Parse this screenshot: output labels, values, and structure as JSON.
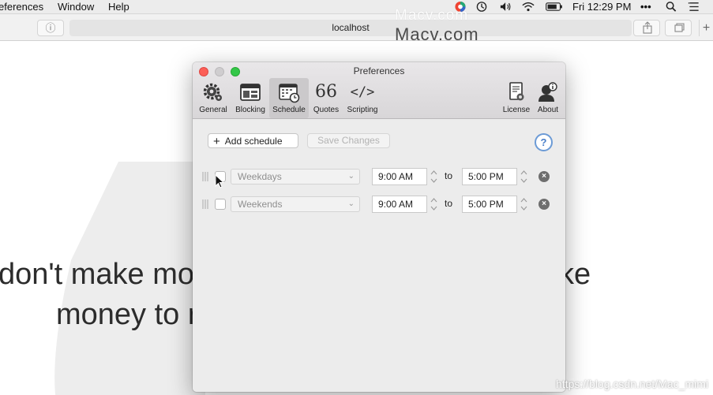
{
  "menubar": {
    "app_menu_partial": "eferences",
    "window_menu": "Window",
    "help_menu": "Help",
    "clock": "Fri 12:29 PM",
    "more_glyph": "•••"
  },
  "browser": {
    "url": "localhost",
    "reader_glyph": "ⓘ",
    "new_tab_glyph": "+"
  },
  "watermark": {
    "top_light": "Macv.com",
    "top_dark": "Macv.com",
    "bottom_right": "https://blog.csdn.net/Mac_mimi"
  },
  "page": {
    "hero_line1": "don't make mov",
    "hero_line2": "money to r",
    "hero_right": "ke"
  },
  "prefs": {
    "title": "Preferences",
    "tabs": [
      {
        "label": "General",
        "icon": "gear-icon"
      },
      {
        "label": "Blocking",
        "icon": "window-blocking-icon"
      },
      {
        "label": "Schedule",
        "icon": "calendar-clock-icon",
        "active": true
      },
      {
        "label": "Quotes",
        "icon": "quote-icon"
      },
      {
        "label": "Scripting",
        "icon": "code-brackets-icon"
      },
      {
        "label": "License",
        "icon": "certificate-icon"
      },
      {
        "label": "About",
        "icon": "person-info-icon"
      }
    ],
    "quote_glyph": "66",
    "scripting_glyph": "</>",
    "add_button": "Add schedule",
    "add_glyph": "+",
    "save_button": "Save Changes",
    "help_glyph": "?",
    "to_label": "to",
    "delete_glyph": "×",
    "chevron_glyph": "⌵",
    "schedules": [
      {
        "days": "Weekdays",
        "start": "9:00 AM",
        "end": "5:00 PM",
        "enabled": false
      },
      {
        "days": "Weekends",
        "start": "9:00 AM",
        "end": "5:00 PM",
        "enabled": false
      }
    ]
  },
  "colors": {
    "close": "#fc5f57",
    "maximize": "#33c748",
    "help_blue": "#4a7fc8"
  }
}
